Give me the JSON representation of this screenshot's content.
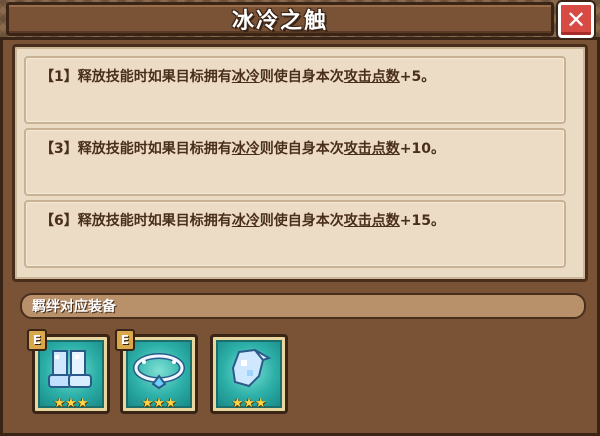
{
  "dialog": {
    "title": "冰冷之触",
    "close_label": "✕"
  },
  "effects": [
    {
      "level": "【1】",
      "prefix": "释放技能时如果目标拥有",
      "keyword1": "冰冷",
      "middle": "则使自身本次",
      "keyword2": "攻击点数",
      "suffix": "+5。"
    },
    {
      "level": "【3】",
      "prefix": "释放技能时如果目标拥有",
      "keyword1": "冰冷",
      "middle": "则使自身本次",
      "keyword2": "攻击点数",
      "suffix": "+10。"
    },
    {
      "level": "【6】",
      "prefix": "释放技能时如果目标拥有",
      "keyword1": "冰冷",
      "middle": "则使自身本次",
      "keyword2": "攻击点数",
      "suffix": "+15。"
    }
  ],
  "equipment": {
    "header": "羁绊对应装备",
    "items": [
      {
        "icon": "boots-icon",
        "grade": "E",
        "stars": "★★★"
      },
      {
        "icon": "collar-icon",
        "grade": "E",
        "stars": "★★★"
      },
      {
        "icon": "gauntlet-icon",
        "grade": "",
        "stars": "★★★"
      }
    ]
  },
  "colors": {
    "frame": "#7a5236",
    "panel": "#eadbc4",
    "close": "#d84a44",
    "equip_bg": "#2cb0a8",
    "star": "#ffd84a"
  }
}
